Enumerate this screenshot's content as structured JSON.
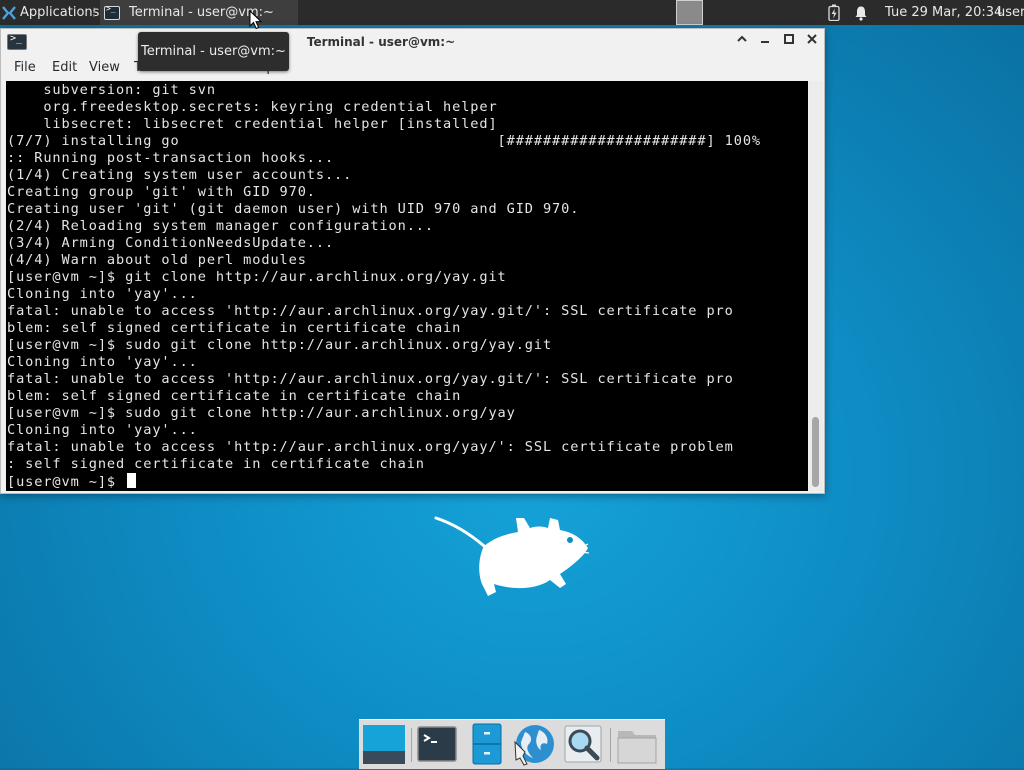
{
  "panel": {
    "applications_label": "Applications",
    "separator": "⁝",
    "task_title": "Terminal - user@vm:~",
    "clock": "Tue 29 Mar, 20:34",
    "user": "user"
  },
  "tooltip": {
    "text": "Terminal - user@vm:~"
  },
  "window": {
    "title": "Terminal - user@vm:~",
    "menu": [
      "File",
      "Edit",
      "View",
      "Terminal",
      "Tabs",
      "Help"
    ]
  },
  "terminal": {
    "lines": [
      "    subversion: git svn",
      "    org.freedesktop.secrets: keyring credential helper",
      "    libsecret: libsecret credential helper [installed]",
      "(7/7) installing go                                   [######################] 100%",
      ":: Running post-transaction hooks...",
      "(1/4) Creating system user accounts...",
      "Creating group 'git' with GID 970.",
      "Creating user 'git' (git daemon user) with UID 970 and GID 970.",
      "(2/4) Reloading system manager configuration...",
      "(3/4) Arming ConditionNeedsUpdate...",
      "(4/4) Warn about old perl modules",
      "[user@vm ~]$ git clone http://aur.archlinux.org/yay.git",
      "Cloning into 'yay'...",
      "fatal: unable to access 'http://aur.archlinux.org/yay.git/': SSL certificate pro",
      "blem: self signed certificate in certificate chain",
      "[user@vm ~]$ sudo git clone http://aur.archlinux.org/yay.git",
      "Cloning into 'yay'...",
      "fatal: unable to access 'http://aur.archlinux.org/yay.git/': SSL certificate pro",
      "blem: self signed certificate in certificate chain",
      "[user@vm ~]$ sudo git clone http://aur.archlinux.org/yay",
      "Cloning into 'yay'...",
      "fatal: unable to access 'http://aur.archlinux.org/yay/': SSL certificate problem",
      ": self signed certificate in certificate chain"
    ],
    "prompt": "[user@vm ~]$ "
  },
  "dock": {
    "items": [
      "show-desktop",
      "terminal",
      "file-manager",
      "web-browser",
      "app-finder",
      "home-folder"
    ]
  },
  "colors": {
    "desktop": "#0e8cc4",
    "panel": "#2b2b2b",
    "terminal_bg": "#000000",
    "terminal_fg": "#e5e5e5"
  }
}
